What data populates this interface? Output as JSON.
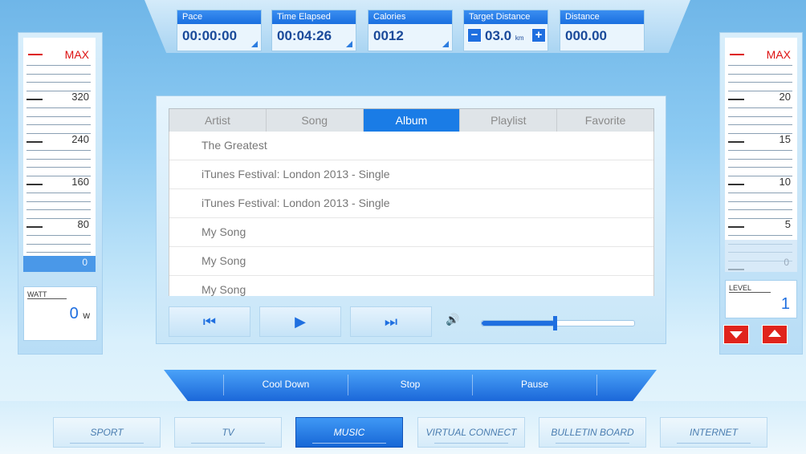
{
  "stats": {
    "pace": {
      "label": "Pace",
      "value": "00:00:00"
    },
    "time_elapsed": {
      "label": "Time Elapsed",
      "value": "00:04:26"
    },
    "calories": {
      "label": "Calories",
      "value": "0012"
    },
    "target_distance": {
      "label": "Target Distance",
      "value": "03.0",
      "unit": "km",
      "minus": "−",
      "plus": "+"
    },
    "distance": {
      "label": "Distance",
      "value": "000.00"
    }
  },
  "left_gauge": {
    "max_label": "MAX",
    "ticks": [
      "320",
      "240",
      "160",
      "80",
      "0"
    ]
  },
  "right_gauge": {
    "max_label": "MAX",
    "ticks": [
      "20",
      "15",
      "10",
      "5",
      "0"
    ]
  },
  "watt": {
    "label": "WATT",
    "value": "0",
    "unit": "w"
  },
  "level": {
    "label": "LEVEL",
    "value": "1"
  },
  "music": {
    "tabs": [
      "Artist",
      "Song",
      "Album",
      "Playlist",
      "Favorite"
    ],
    "active_tab": "Album",
    "rows": [
      "The Greatest",
      "iTunes Festival: London 2013 - Single",
      "iTunes Festival: London 2013 - Single",
      "My Song",
      "My Song",
      "My Song"
    ],
    "volume": 0.48
  },
  "controls": {
    "cool_down": "Cool Down",
    "stop": "Stop",
    "pause": "Pause"
  },
  "nav": [
    "SPORT",
    "TV",
    "MUSIC",
    "VIRTUAL CONNECT",
    "BULLETIN BOARD",
    "INTERNET"
  ],
  "nav_active": "MUSIC",
  "colors": {
    "accent": "#1a7ce6",
    "danger": "#e0241c",
    "max_red": "#dd1111"
  }
}
